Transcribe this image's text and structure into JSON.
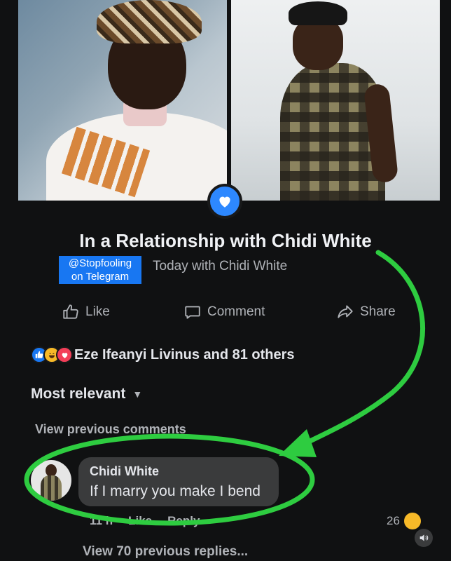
{
  "post": {
    "headline": "In a Relationship with Chidi White",
    "subline": "Today with Chidi White",
    "watermark_line1": "@Stopfooling",
    "watermark_line2": "on Telegram"
  },
  "actions": {
    "like": "Like",
    "comment": "Comment",
    "share": "Share"
  },
  "reactions": {
    "summary": "Eze Ifeanyi Livinus and 81 others"
  },
  "comments": {
    "sort_label": "Most relevant",
    "view_previous": "View previous comments",
    "comment": {
      "author": "Chidi White",
      "text": "If I marry you make I bend",
      "time": "11 h",
      "like": "Like",
      "reply": "Reply",
      "reaction_count": "26"
    },
    "view_replies": "View 70 previous replies..."
  },
  "colors": {
    "accent": "#2d88ff",
    "annotation": "#2ecc40",
    "background": "#101112"
  },
  "icons": [
    "heart-icon",
    "thumbs-up-icon",
    "comment-icon",
    "share-icon",
    "chevron-down-icon",
    "sound-icon"
  ]
}
